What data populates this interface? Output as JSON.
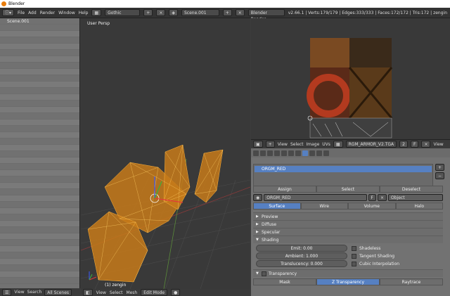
{
  "window": {
    "title": "Blender"
  },
  "menubar": {
    "items": [
      "File",
      "Add",
      "Render",
      "Window",
      "Help"
    ],
    "screen_layout": "Gothic",
    "scene": "Scene.001",
    "render_engine": "Blender Render",
    "info": "v2.66.1 | Verts:179/179 | Edges:333/333 | Faces:172/172 | Tris:172 | zengin"
  },
  "outliner": {
    "scene_item": "Scene.001",
    "footer": {
      "view": "View",
      "search": "Search",
      "filter": "All Scenes"
    }
  },
  "viewport": {
    "label": "User Persp",
    "object_label": "(1) zengin",
    "footer": {
      "view": "View",
      "select": "Select",
      "mesh": "Mesh",
      "mode": "Edit Mode"
    }
  },
  "image_editor": {
    "footer": {
      "view": "View",
      "select": "Select",
      "image": "Image",
      "uvs": "UVs",
      "image_name": "RGM_ARMOR_V2.TGA",
      "frame": "2",
      "f": "F",
      "view2": "View"
    }
  },
  "properties": {
    "material_slot": "ORGM_RED",
    "assign": "Assign",
    "select": "Select",
    "deselect": "Deselect",
    "material_name": "ORGM_RED",
    "f_label": "F",
    "link": "Object",
    "tabs": [
      "Surface",
      "Wire",
      "Volume",
      "Halo"
    ],
    "panels": {
      "preview": "Preview",
      "diffuse": "Diffuse",
      "specular": "Specular",
      "shading": "Shading",
      "transparency": "Transparency"
    },
    "shading": {
      "emit": "Emit: 0.00",
      "ambient": "Ambient: 1.000",
      "translucency": "Translucency: 0.000",
      "shadeless": "Shadeless",
      "tangent": "Tangent Shading",
      "cubic": "Cubic Interpolation"
    },
    "transparency_tabs": [
      "Mask",
      "Z Transparency",
      "Raytrace"
    ]
  }
}
